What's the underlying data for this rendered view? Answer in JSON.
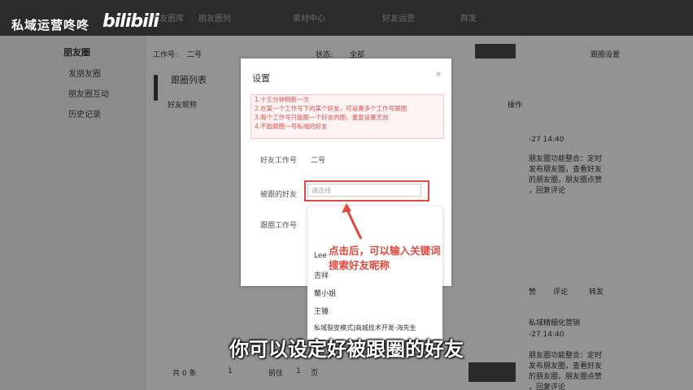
{
  "brand": {
    "text": "私域运营咚咚",
    "logo": "bilibili"
  },
  "topnav": {
    "items": [
      "朋友圈库",
      "朋友圈列",
      "素材中心",
      "好友运营",
      "群发"
    ]
  },
  "sidebar": {
    "title": "朋友圈",
    "items": [
      "发朋友圈",
      "朋友圈互动",
      "历史记录"
    ]
  },
  "filters": {
    "worker_label": "工作号:",
    "worker_value": "二号",
    "status_label": "状态:",
    "status_value": "全部",
    "settings_link": "跟圈设置"
  },
  "panel": {
    "title": "跟圈列表",
    "col_nickname": "好友昵称",
    "col_action": "操作"
  },
  "feed": {
    "time1": "-27 14:40",
    "text1": [
      "朋友圈功能整合：定时",
      "发布朋友圈，查看好友",
      "的朋友圈，朋友圈点赞",
      "，回复评论"
    ],
    "actions": [
      "赞",
      "评论",
      "转发"
    ],
    "title2": "私域精细化营销",
    "time2": "-27 14:40",
    "text2": [
      "朋友圈功能整合：定时",
      "发布朋友圈，查看好友",
      "的朋友圈，朋友圈点赞",
      "，回复评论"
    ]
  },
  "modal": {
    "title": "设置",
    "close": "×",
    "notice": [
      "1.十五分钟刷新一次",
      "2.在某一个工作号下的某个好友，可设置多个工作号跟圈",
      "3.每个工作号只能跟一个好友的圈，重复设置无效",
      "4.不能跟圈一号私域的好友"
    ],
    "friend_worker_label": "好友工作号",
    "friend_worker_value": "二号",
    "followed_friend_label": "被跟的好友",
    "followed_friend_placeholder": "请选择",
    "follow_worker_label": "跟圈工作号"
  },
  "dropdown": {
    "items": [
      "Lee",
      "吉祥",
      "蘭小姐",
      "王锤",
      "私域裂变模式|商城技术开发-海先生"
    ]
  },
  "annotation": [
    "点击后，可以输入关键词",
    "搜索好友昵称"
  ],
  "footer": {
    "total": "共 0 条",
    "page": "1",
    "goto_label": "前往",
    "goto_value": "1",
    "page_unit": "页"
  },
  "subtitle": "你可以设定好被跟圈的好友"
}
